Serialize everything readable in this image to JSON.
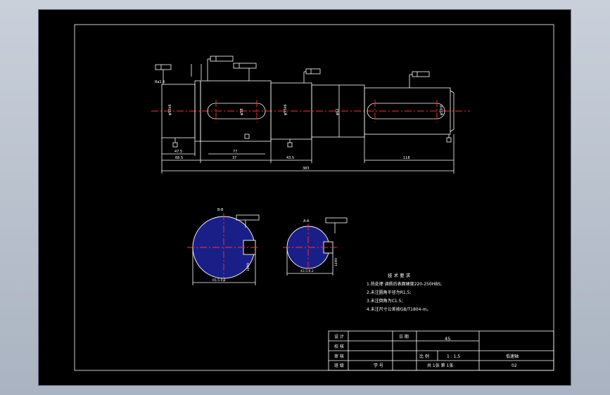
{
  "drawing": {
    "dimensions": {
      "d1": "47.5",
      "d2": "68.5",
      "d3": "77",
      "d4": "43.5",
      "d5": "383",
      "d6": "37",
      "d7": "118"
    },
    "sections": {
      "left_label": "B-B",
      "right_label": "A-A",
      "left_dim": "65.5-0.2",
      "right_dim": "43.5-0.2"
    },
    "requirements": {
      "title": "技 术 要 求",
      "items": [
        "1.热处理 调质后表面硬度220-250HBS;",
        "2.未注圆角半径为R1.5;",
        "3.未注倒角为C1.5;",
        "4.未注尺寸公差按GB/T1804-m。"
      ]
    },
    "title_block": {
      "design": "设 计",
      "check": "校 核",
      "approve": "审 核",
      "class": "班 级",
      "date": "日 期",
      "material": "45",
      "scale_label": "比 例",
      "scale_value": "1 : 1.5",
      "part_name": "低速轴",
      "sheets": "共 1张  第 1张",
      "drawing_no": "02",
      "student_no": "学 号"
    }
  }
}
